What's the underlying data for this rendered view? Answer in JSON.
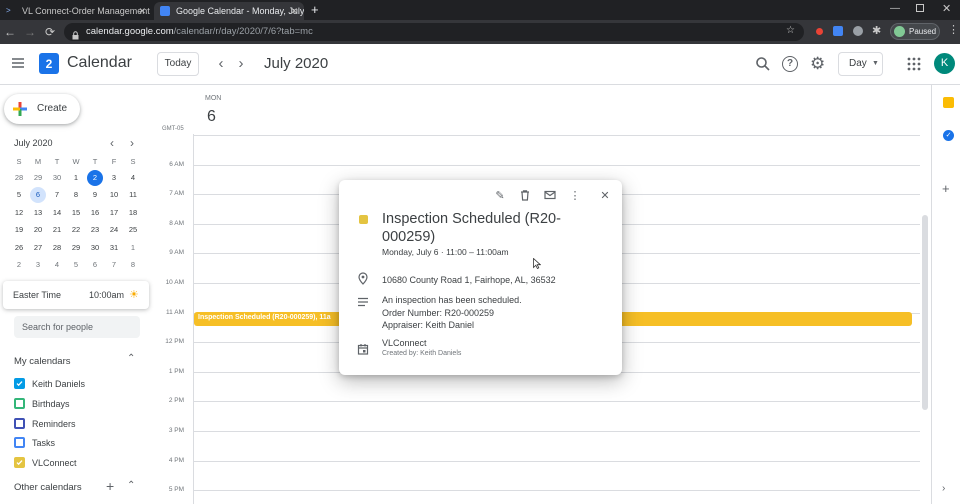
{
  "browser": {
    "tabs": [
      {
        "title": "VL Connect-Order Management",
        "active": false
      },
      {
        "title": "Google Calendar - Monday, July 6",
        "active": true
      }
    ],
    "new_tab": "+",
    "url_host": "calendar.google.com",
    "url_path": "/calendar/r/day/2020/7/6?tab=mc",
    "profile_label": "Paused",
    "nav": {
      "back": "←",
      "forward": "→",
      "reload": "⟳"
    }
  },
  "header": {
    "app_name": "Calendar",
    "logo_day": "2",
    "today_label": "Today",
    "month_title": "July 2020",
    "view_label": "Day",
    "avatar_initial": "K"
  },
  "sidebar": {
    "create_label": "Create",
    "minical": {
      "month_label": "July 2020",
      "weekdays": [
        "S",
        "M",
        "T",
        "W",
        "T",
        "F",
        "S"
      ],
      "weeks": [
        [
          "28",
          "29",
          "30",
          "1",
          "2",
          "3",
          "4"
        ],
        [
          "5",
          "6",
          "7",
          "8",
          "9",
          "10",
          "11"
        ],
        [
          "12",
          "13",
          "14",
          "15",
          "16",
          "17",
          "18"
        ],
        [
          "19",
          "20",
          "21",
          "22",
          "23",
          "24",
          "25"
        ],
        [
          "26",
          "27",
          "28",
          "29",
          "30",
          "31",
          "1"
        ],
        [
          "2",
          "3",
          "4",
          "5",
          "6",
          "7",
          "8"
        ]
      ]
    },
    "easter_card": {
      "title": "Easter Time",
      "time": "10:00am"
    },
    "search_people_placeholder": "Search for people",
    "my_calendars_label": "My calendars",
    "my_calendars": [
      {
        "label": "Keith Daniels",
        "color": "#039be5",
        "checked": true
      },
      {
        "label": "Birthdays",
        "color": "#33b679",
        "checked": false
      },
      {
        "label": "Reminders",
        "color": "#3f51b5",
        "checked": false
      },
      {
        "label": "Tasks",
        "color": "#4285f4",
        "checked": false
      },
      {
        "label": "VLConnect",
        "color": "#e4c441",
        "checked": true
      }
    ],
    "other_calendars_label": "Other calendars"
  },
  "day_view": {
    "weekday": "MON",
    "day_number": "6",
    "timezone": "GMT-05",
    "hours": [
      "6 AM",
      "7 AM",
      "8 AM",
      "9 AM",
      "10 AM",
      "11 AM",
      "12 PM",
      "1 PM",
      "2 PM",
      "3 PM",
      "4 PM",
      "5 PM"
    ],
    "event_bar_text": "Inspection Scheduled (R20-000259), 11a"
  },
  "event_popup": {
    "title_line1": "Inspection Scheduled (R20-",
    "title_line2": "000259)",
    "color": "#e4c441",
    "date_time": "Monday, July 6  ·  11:00 – 11:00am",
    "location": "10680 County Road 1, Fairhope, AL, 36532",
    "description_lines": [
      "An inspection has been scheduled.",
      "Order Number: R20-000259",
      "Appraiser: Keith Daniel"
    ],
    "calendar_name": "VLConnect",
    "created_by": "Created by: Keith Daniels"
  }
}
